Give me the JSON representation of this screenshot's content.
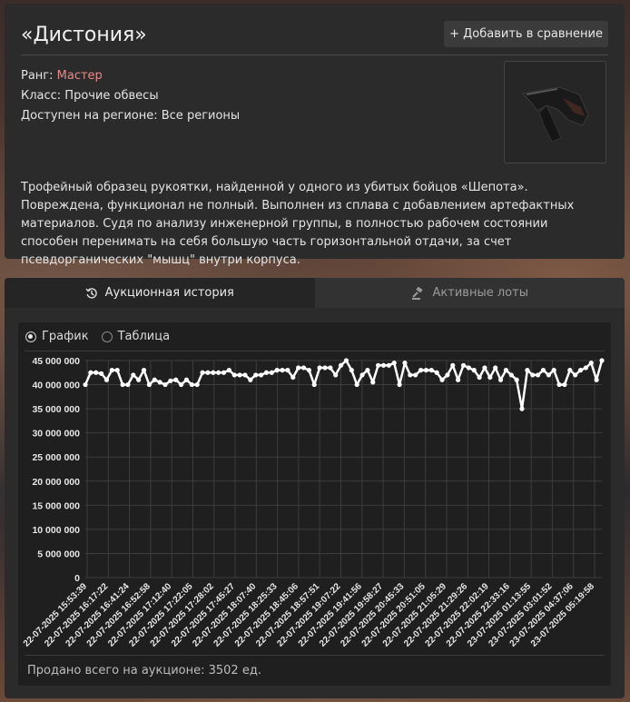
{
  "item": {
    "title": "«Дистония»",
    "compare_button": "+ Добавить в сравнение",
    "rank_label": "Ранг:",
    "rank_value": "Мастер",
    "class_line": "Класс: Прочие обвесы",
    "region_line": "Доступен на регионе: Все регионы",
    "description": "Трофейный образец рукоятки, найденной у одного из убитых бойцов «Шепота». Повреждена, функционал не полный. Выполнен из сплава с добавлением артефактных материалов. Судя по анализу инженерной группы, в полностью рабочем состоянии способен перенимать на себя большую часть горизонтальной отдачи, за счет псевдорганических \"мышц\" внутри корпуса."
  },
  "tabs": {
    "history": "Аукционная история",
    "lots": "Активные лоты"
  },
  "view_toggle": {
    "chart": "График",
    "table": "Таблица",
    "selected": "chart"
  },
  "footer": "Продано всего на аукционе: 3502 ед.",
  "colors": {
    "line": "#ffffff",
    "grid": "#3d3d3d",
    "rank": "#e88a8a"
  },
  "chart_data": {
    "type": "line",
    "ylim": [
      0,
      45000000
    ],
    "yticks": [
      "0",
      "5 000 000",
      "10 000 000",
      "15 000 000",
      "20 000 000",
      "25 000 000",
      "30 000 000",
      "35 000 000",
      "40 000 000",
      "45 000 000"
    ],
    "x": [
      "22-07-2025 15:53:39",
      "22-07-2025 16:17:22",
      "22-07-2025 16:41:24",
      "22-07-2025 16:52:58",
      "22-07-2025 17:12:40",
      "22-07-2025 17:22:05",
      "22-07-2025 17:28:02",
      "22-07-2025 17:45:27",
      "22-07-2025 18:07:40",
      "22-07-2025 18:25:33",
      "22-07-2025 18:45:06",
      "22-07-2025 18:57:51",
      "22-07-2025 19:07:22",
      "22-07-2025 19:41:56",
      "22-07-2025 19:58:27",
      "22-07-2025 20:45:33",
      "22-07-2025 20:51:05",
      "22-07-2025 21:05:29",
      "22-07-2025 21:29:26",
      "22-07-2025 22:02:19",
      "22-07-2025 22:33:16",
      "23-07-2025 01:13:55",
      "23-07-2025 03:01:52",
      "23-07-2025 04:37:06",
      "23-07-2025 05:19:58"
    ],
    "values": [
      40000000,
      42500000,
      42500000,
      42300000,
      41000000,
      43000000,
      43000000,
      40000000,
      40000000,
      42000000,
      41000000,
      43000000,
      40000000,
      41000000,
      40500000,
      40000000,
      40800000,
      41000000,
      40000000,
      41000000,
      40000000,
      40000000,
      42500000,
      42500000,
      42500000,
      42500000,
      42500000,
      43000000,
      42000000,
      42000000,
      42000000,
      41000000,
      42000000,
      42000000,
      42500000,
      42500000,
      43000000,
      43000000,
      43000000,
      41500000,
      43500000,
      43500000,
      43000000,
      40000000,
      43500000,
      43500000,
      43500000,
      42000000,
      44000000,
      45000000,
      43000000,
      40000000,
      42000000,
      43000000,
      40500000,
      44000000,
      44000000,
      44000000,
      44500000,
      40000000,
      44500000,
      42000000,
      42000000,
      43000000,
      43000000,
      43000000,
      42500000,
      41000000,
      42000000,
      44000000,
      41000000,
      44000000,
      43500000,
      43000000,
      41500000,
      43500000,
      41500000,
      43500000,
      41000000,
      43000000,
      42000000,
      41000000,
      35000000,
      43000000,
      42000000,
      42000000,
      43000000,
      42000000,
      43000000,
      40000000,
      40000000,
      43000000,
      42000000,
      43000000,
      43500000,
      44500000,
      41000000,
      45000000
    ]
  }
}
